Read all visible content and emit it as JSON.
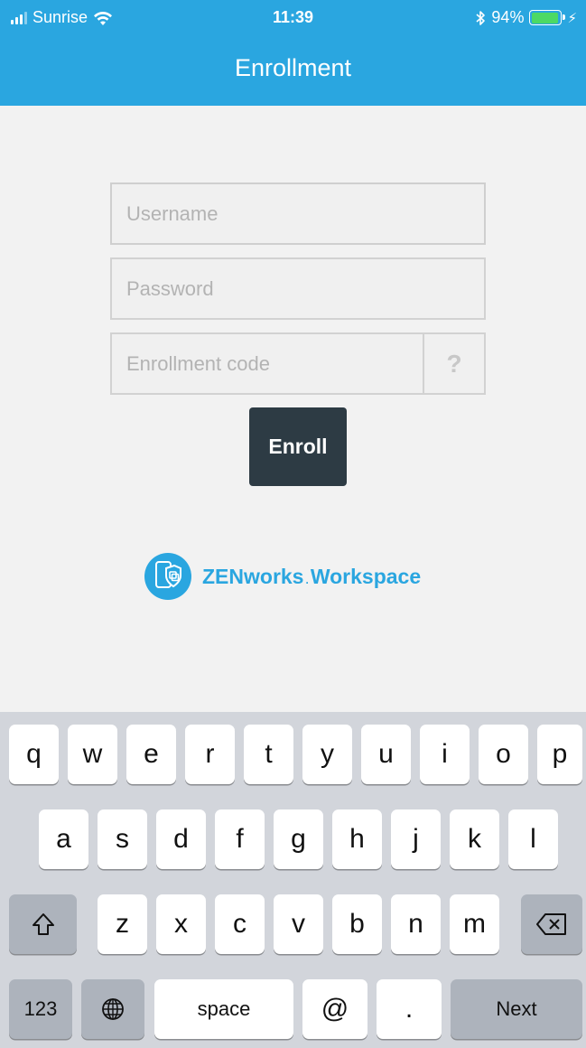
{
  "status_bar": {
    "carrier": "Sunrise",
    "time": "11:39",
    "battery_percent": "94%",
    "battery_level": 0.94
  },
  "header": {
    "title": "Enrollment"
  },
  "form": {
    "username_placeholder": "Username",
    "username_value": "",
    "password_placeholder": "Password",
    "password_value": "",
    "enrollment_code_placeholder": "Enrollment code",
    "enrollment_code_value": "",
    "help_label": "?",
    "enroll_label": "Enroll"
  },
  "brand": {
    "name_part1": "ZENworks",
    "dot": ".",
    "name_part2": "Workspace",
    "color": "#2aa6e0"
  },
  "colors": {
    "header_bg": "#2aa6e0",
    "button_bg": "#2d3b44",
    "battery": "#4cd964"
  },
  "keyboard": {
    "row1": [
      "q",
      "w",
      "e",
      "r",
      "t",
      "y",
      "u",
      "i",
      "o",
      "p"
    ],
    "row2": [
      "a",
      "s",
      "d",
      "f",
      "g",
      "h",
      "j",
      "k",
      "l"
    ],
    "row3": [
      "z",
      "x",
      "c",
      "v",
      "b",
      "n",
      "m"
    ],
    "shift_icon": "shift-icon",
    "backspace_icon": "backspace-icon",
    "numbers_label": "123",
    "globe_icon": "globe-icon",
    "space_label": "space",
    "at_label": "@",
    "period_label": ".",
    "next_label": "Next"
  }
}
